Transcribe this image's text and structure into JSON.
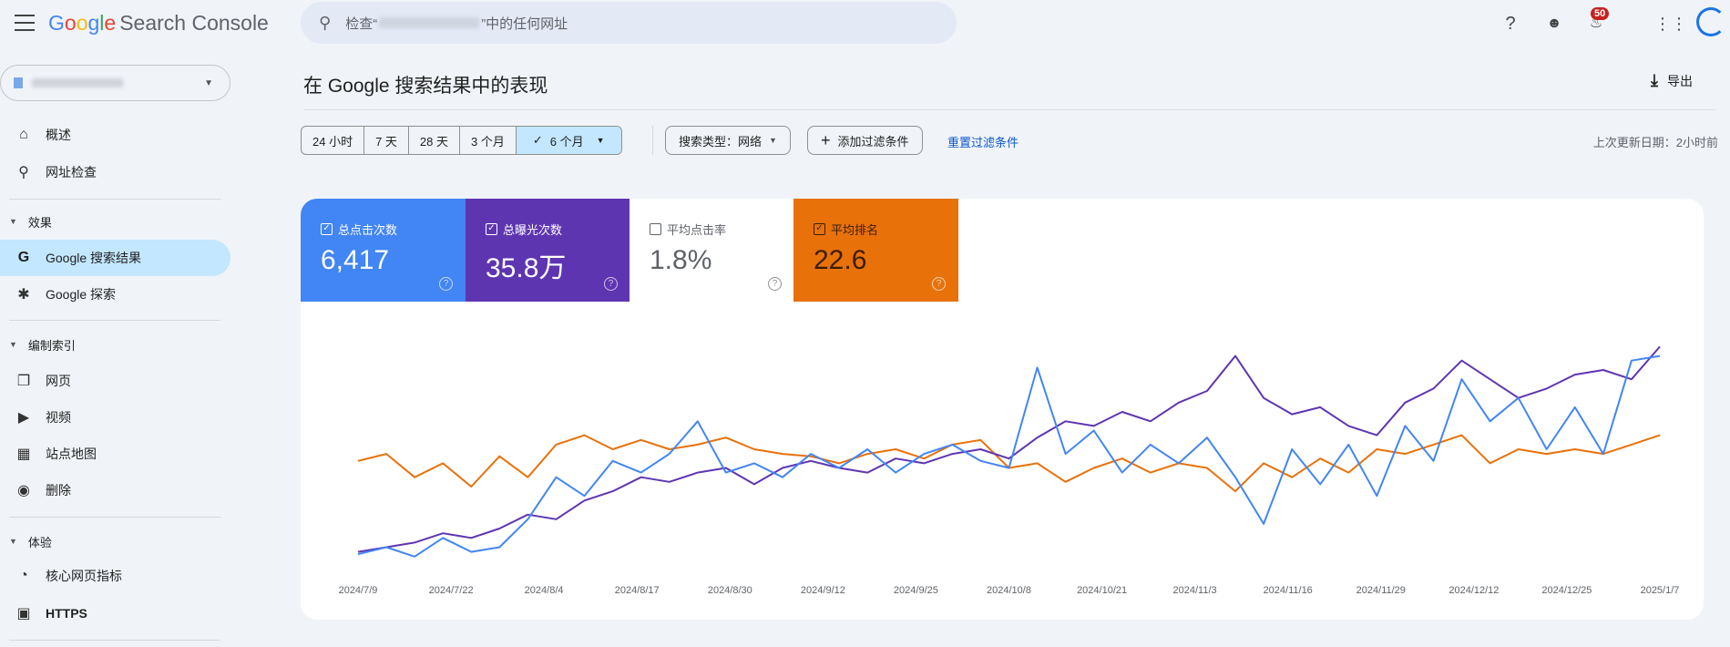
{
  "header": {
    "logo_google": "Google",
    "logo_product": "Search Console",
    "search_prefix": "检查“",
    "search_suffix": "”中的任何网址",
    "notification_count": "50"
  },
  "sidebar": {
    "items_top": [
      {
        "label": "概述",
        "icon": "home-icon"
      },
      {
        "label": "网址检查",
        "icon": "search-icon"
      }
    ],
    "sections": [
      {
        "title": "效果",
        "items": [
          {
            "label": "Google 搜索结果",
            "icon": "google-g-icon",
            "active": true
          },
          {
            "label": "Google 探索",
            "icon": "asterisk-icon"
          }
        ]
      },
      {
        "title": "编制索引",
        "items": [
          {
            "label": "网页",
            "icon": "pages-icon"
          },
          {
            "label": "视频",
            "icon": "video-icon"
          },
          {
            "label": "站点地图",
            "icon": "sitemap-icon"
          },
          {
            "label": "删除",
            "icon": "eye-off-icon"
          }
        ]
      },
      {
        "title": "体验",
        "items": [
          {
            "label": "核心网页指标",
            "icon": "gauge-icon"
          },
          {
            "label": "HTTPS",
            "icon": "lock-icon"
          }
        ]
      }
    ]
  },
  "main": {
    "title": "在 Google 搜索结果中的表现",
    "export_label": "导出",
    "date_ranges": [
      "24 小时",
      "7 天",
      "28 天",
      "3 个月",
      "6 个月"
    ],
    "selected_range": "6 个月",
    "search_type": "搜索类型：网络",
    "add_filter": "添加过滤条件",
    "reset_filters": "重置过滤条件",
    "last_updated": "上次更新日期：2小时前",
    "metrics": [
      {
        "label": "总点击次数",
        "value": "6,417",
        "checked": true,
        "color": "#4285f4"
      },
      {
        "label": "总曝光次数",
        "value": "35.8万",
        "checked": true,
        "color": "#5e35b1"
      },
      {
        "label": "平均点击率",
        "value": "1.8%",
        "checked": false,
        "color": "#ffffff"
      },
      {
        "label": "平均排名",
        "value": "22.6",
        "checked": true,
        "color": "#e8710a"
      }
    ]
  },
  "chart_data": {
    "type": "line",
    "title": "",
    "xlabel": "",
    "ylabel": "",
    "note": "relative index scale 0-100, no y axis shown; sampled every 4 days",
    "x_ticks": [
      "2024/7/9",
      "2024/7/22",
      "2024/8/4",
      "2024/8/17",
      "2024/8/30",
      "2024/9/12",
      "2024/9/25",
      "2024/10/8",
      "2024/10/21",
      "2024/11/3",
      "2024/11/16",
      "2024/11/29",
      "2024/12/12",
      "2024/12/25",
      "2025/1/7"
    ],
    "ylim": [
      0,
      100
    ],
    "series": [
      {
        "name": "总点击次数",
        "color": "#4285f4",
        "values": [
          5,
          8,
          4,
          12,
          6,
          8,
          20,
          38,
          30,
          45,
          40,
          48,
          62,
          40,
          44,
          38,
          48,
          42,
          50,
          40,
          48,
          52,
          45,
          42,
          85,
          48,
          58,
          40,
          52,
          44,
          55,
          38,
          18,
          50,
          35,
          52,
          30,
          60,
          45,
          80,
          62,
          72,
          50,
          68,
          48,
          88,
          90
        ]
      },
      {
        "name": "总曝光次数",
        "color": "#5e35b1",
        "values": [
          6,
          8,
          10,
          14,
          12,
          16,
          22,
          20,
          28,
          32,
          38,
          36,
          40,
          42,
          35,
          42,
          45,
          42,
          40,
          46,
          44,
          48,
          50,
          46,
          55,
          62,
          60,
          66,
          62,
          70,
          75,
          90,
          72,
          65,
          68,
          60,
          56,
          70,
          76,
          88,
          80,
          72,
          76,
          82,
          84,
          80,
          94
        ]
      },
      {
        "name": "平均排名",
        "color": "#e8710a",
        "values": [
          45,
          48,
          38,
          44,
          34,
          47,
          38,
          52,
          56,
          50,
          54,
          50,
          52,
          55,
          50,
          48,
          47,
          44,
          48,
          50,
          46,
          52,
          54,
          42,
          44,
          36,
          42,
          46,
          40,
          44,
          42,
          32,
          44,
          38,
          46,
          40,
          50,
          48,
          52,
          56,
          44,
          50,
          48,
          50,
          48,
          52,
          56
        ]
      }
    ]
  }
}
